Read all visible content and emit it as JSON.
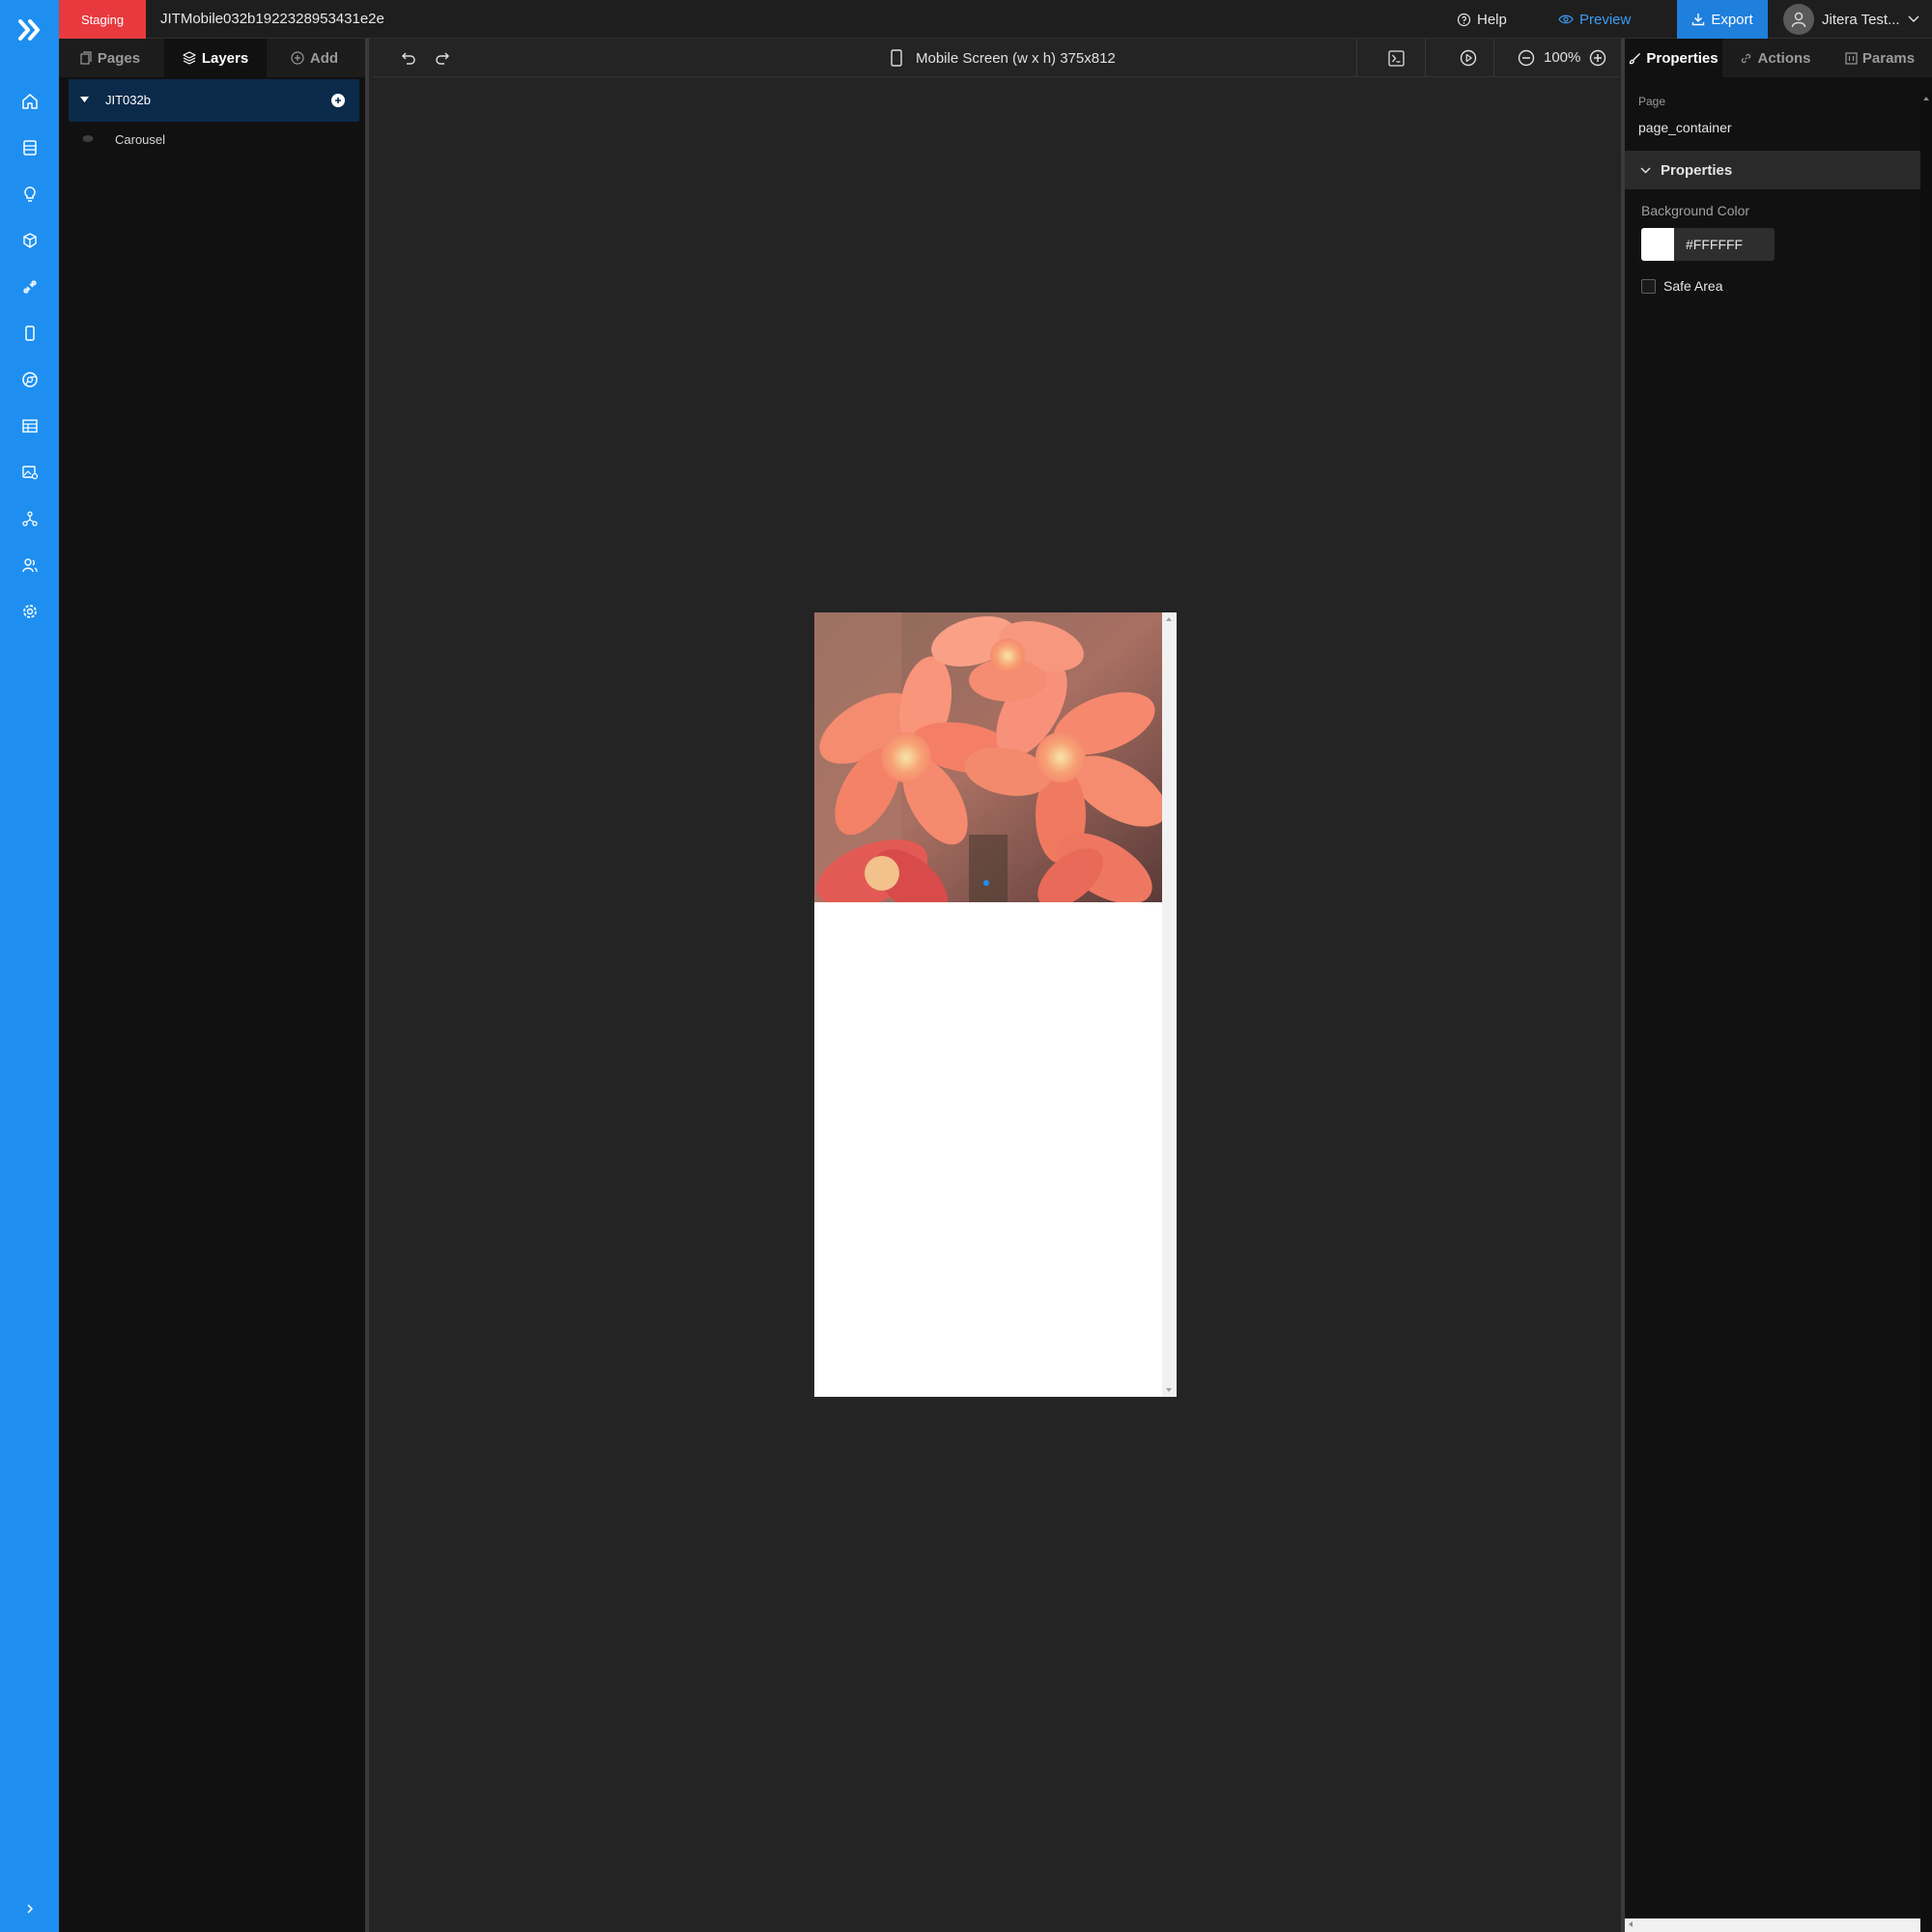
{
  "topbar": {
    "environment_badge": "Staging",
    "project_title": "JITMobile032b1922328953431e2e",
    "help_label": "Help",
    "preview_label": "Preview",
    "export_label": "Export",
    "user_name": "Jitera Test..."
  },
  "sidebar_icons": [
    "logo-icon",
    "home-icon",
    "database-icon",
    "lightbulb-icon",
    "cube-icon",
    "api-icon",
    "mobile-icon",
    "chrome-icon",
    "table-icon",
    "image-icon",
    "hierarchy-icon",
    "users-icon",
    "settings-icon",
    "expand-chevron-icon"
  ],
  "left_panel": {
    "tabs": [
      {
        "label": "Pages",
        "active": false
      },
      {
        "label": "Layers",
        "active": true
      },
      {
        "label": "Add",
        "active": false
      }
    ],
    "layers": [
      {
        "name": "JIT032b",
        "expanded": true,
        "selected": true
      },
      {
        "name": "Carousel",
        "expanded": false,
        "selected": false
      }
    ]
  },
  "canvas_toolbar": {
    "screen_label": "Mobile Screen (w x h) 375x812",
    "zoom_level": "100%"
  },
  "canvas": {
    "carousel_image_subject": "coral flowers photo",
    "carousel_active_dot_color": "#1e8ff0"
  },
  "right_panel": {
    "tabs": [
      {
        "label": "Properties",
        "active": true
      },
      {
        "label": "Actions",
        "active": false
      },
      {
        "label": "Params",
        "active": false
      }
    ],
    "page_label": "Page",
    "page_value": "page_container",
    "section_title": "Properties",
    "background_color_label": "Background Color",
    "background_color_value": "#FFFFFF",
    "safe_area_label": "Safe Area",
    "safe_area_checked": false
  },
  "colors": {
    "accent": "#1e8ff0",
    "staging": "#e8393f",
    "export": "#1e7fdc",
    "preview_link": "#3d9cf5"
  }
}
